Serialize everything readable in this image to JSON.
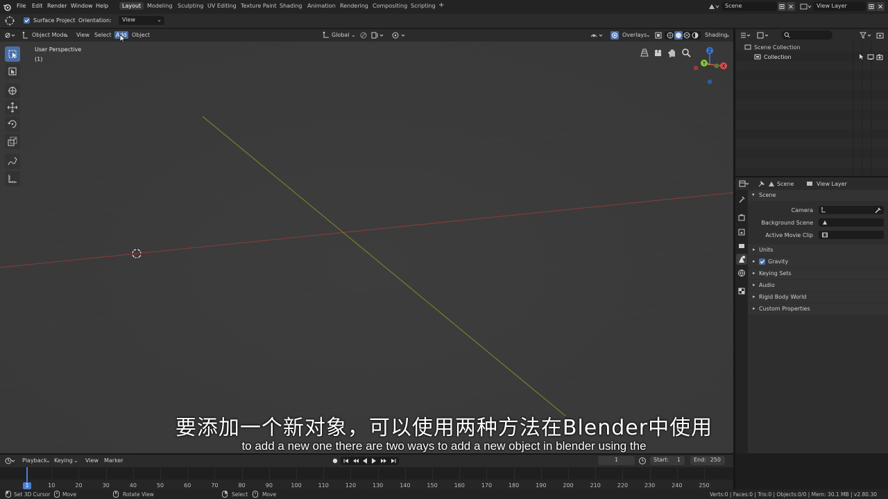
{
  "top_menu": [
    "File",
    "Edit",
    "Render",
    "Window",
    "Help"
  ],
  "workspaces": [
    "Layout",
    "Modeling",
    "Sculpting",
    "UV Editing",
    "Texture Paint",
    "Shading",
    "Animation",
    "Rendering",
    "Compositing",
    "Scripting"
  ],
  "add_workspace": "+",
  "scene_name": "Scene",
  "view_layer_name": "View Layer",
  "toolsettings": {
    "surface_project": "Surface Project",
    "orientation_label": "Orientation:",
    "orientation_value": "View"
  },
  "viewport_header": {
    "mode": "Object Mode",
    "menus": [
      "View",
      "Select",
      "Add",
      "Object"
    ],
    "transform_orientation": "Global",
    "overlays": "Overlays",
    "shading": "Shading"
  },
  "viewport": {
    "view_name": "User Perspective",
    "collection_info": "(1)",
    "gizmo_axes": [
      "Z",
      "Y",
      "X"
    ]
  },
  "outliner": {
    "scene_collection": "Scene Collection",
    "collection": "Collection"
  },
  "properties": {
    "tab_scene": "Scene",
    "tab_view_layer": "View Layer",
    "panel_scene": "Scene",
    "camera_label": "Camera",
    "background_scene_label": "Background Scene",
    "active_movie_clip_label": "Active Movie Clip",
    "panels": [
      "Units",
      "Gravity",
      "Keying Sets",
      "Audio",
      "Rigid Body World",
      "Custom Properties"
    ]
  },
  "timeline": {
    "menus": [
      "Playback",
      "Keying",
      "View",
      "Marker"
    ],
    "current_frame": "1",
    "start_label": "Start:",
    "start_value": "1",
    "end_label": "End:",
    "end_value": "250",
    "ticks": [
      "1",
      "10",
      "20",
      "30",
      "40",
      "50",
      "60",
      "70",
      "80",
      "90",
      "100",
      "110",
      "120",
      "130",
      "140",
      "150",
      "160",
      "170",
      "180",
      "190",
      "200",
      "210",
      "220",
      "230",
      "240",
      "250"
    ]
  },
  "status_bar": {
    "left": [
      "Set 3D Cursor",
      "Move",
      "Rotate View",
      "Select",
      "Move"
    ],
    "stats": "Verts:0 | Faces:0 | Tris:0 | Objects:0/0 | Mem: 30.1 MB | v2.80.30"
  },
  "subtitles": {
    "chinese": "要添加一个新对象，可以使用两种方法在Blender中使用",
    "english": "to add a new one there are two ways to add a new object in blender using the"
  },
  "colors": {
    "accent": "#4a6fa8",
    "x_axis": "#8c3c3c",
    "y_axis": "#7a8a28",
    "gizmo_x": "#e84a4a",
    "gizmo_y": "#8cc43a",
    "gizmo_z": "#3c78dc"
  }
}
